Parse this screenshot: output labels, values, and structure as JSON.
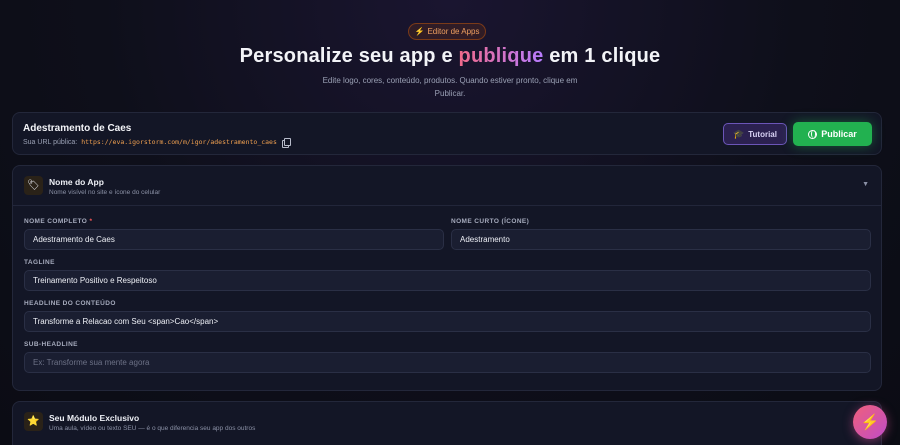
{
  "header": {
    "badge_icon": "⚡",
    "badge_label": "Editor de Apps",
    "title_part1": "Personalize seu app e ",
    "title_accent": "publique",
    "title_part2": " em 1 clique",
    "subtitle": "Edite logo, cores, conteúdo, produtos. Quando estiver pronto, clique em Publicar."
  },
  "app_card": {
    "name": "Adestramento de Caes",
    "url_label": "Sua URL pública:",
    "url": "https://eva.igorstorm.com/m/igor/adestramento_caes",
    "tutorial_label": "Tutorial",
    "publish_label": "Publicar"
  },
  "section_app_name": {
    "icon": "🏷",
    "title": "Nome do App",
    "description": "Nome visível no site e ícone do celular",
    "fields": {
      "full_name_label": "NOME COMPLETO",
      "full_name_required": "*",
      "full_name_value": "Adestramento de Caes",
      "short_name_label": "NOME CURTO (ÍCONE)",
      "short_name_value": "Adestramento",
      "tagline_label": "TAGLINE",
      "tagline_value": "Treinamento Positivo e Respeitoso",
      "headline_label": "HEADLINE DO CONTEÚDO",
      "headline_value": "Transforme a Relacao com Seu <span>Cao</span>",
      "subheadline_label": "SUB-HEADLINE",
      "subheadline_placeholder": "Ex: Transforme sua mente agora"
    }
  },
  "section_module": {
    "icon": "⭐",
    "title": "Seu Módulo Exclusivo",
    "description": "Uma aula, vídeo ou texto SEU — é o que diferencia seu app dos outros"
  },
  "fab_icon": "⚡",
  "colors": {
    "accent_orange": "#f0a050",
    "publish_green": "#22b150",
    "tutorial_purple": "#6b55b8",
    "title_gradient_start": "#f06a8a",
    "title_gradient_end": "#b77cff"
  }
}
